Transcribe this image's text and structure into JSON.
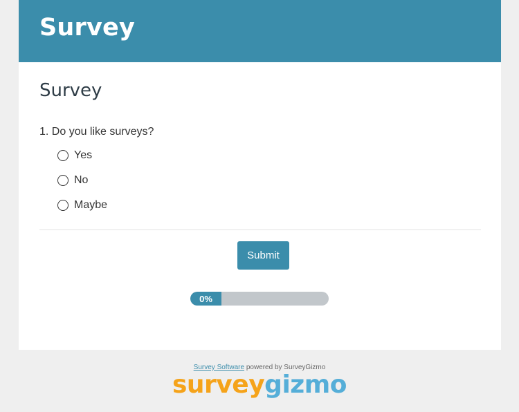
{
  "header": {
    "title": "Survey"
  },
  "survey": {
    "heading": "Survey",
    "question": {
      "text": "1. Do you like surveys?",
      "options": [
        "Yes",
        "No",
        "Maybe"
      ]
    }
  },
  "actions": {
    "submit_label": "Submit"
  },
  "progress": {
    "label": "0%",
    "value": 0
  },
  "footer": {
    "link_text": "Survey Software",
    "suffix": " powered by SurveyGizmo",
    "logo_part1": "survey",
    "logo_part2": "gizmo"
  },
  "colors": {
    "brand": "#3b8dab",
    "progress_track": "#c2c7cb",
    "logo_orange": "#f5a31a",
    "logo_blue": "#55aed8"
  }
}
